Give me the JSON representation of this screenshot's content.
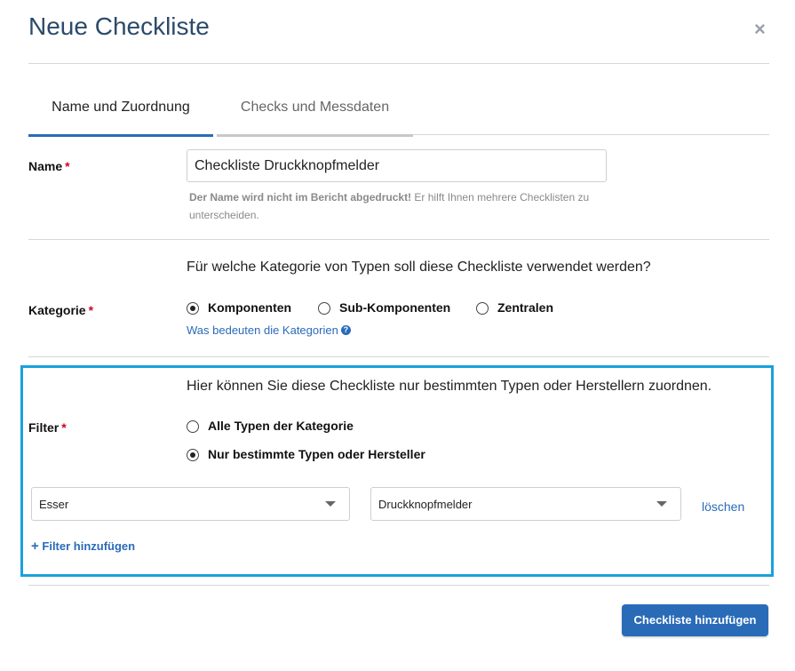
{
  "dialog": {
    "title": "Neue Checkliste",
    "close_glyph": "×"
  },
  "tabs": [
    {
      "label": "Name und Zuordnung",
      "active": true
    },
    {
      "label": "Checks und Messdaten",
      "active": false
    }
  ],
  "name": {
    "label": "Name",
    "required": "*",
    "value": "Checkliste Druckknopfmelder",
    "hint_bold": "Der Name wird nicht im Bericht abgedruckt!",
    "hint_text": " Er hilft Ihnen mehrere Checklisten zu unterscheiden."
  },
  "category": {
    "label": "Kategorie",
    "required": "*",
    "question": "Für welche Kategorie von Typen soll diese Checkliste verwendet werden?",
    "options": [
      {
        "label": "Komponenten",
        "checked": true
      },
      {
        "label": "Sub-Komponenten",
        "checked": false
      },
      {
        "label": "Zentralen",
        "checked": false
      }
    ],
    "help_link": "Was bedeuten die Kategorien",
    "help_icon": "?"
  },
  "filter": {
    "label": "Filter",
    "required": "*",
    "question": "Hier können Sie diese Checkliste nur bestimmten Typen oder Herstellern zuordnen.",
    "options": [
      {
        "label": "Alle Typen der Kategorie",
        "checked": false
      },
      {
        "label": "Nur bestimmte Typen oder Hersteller",
        "checked": true
      }
    ],
    "manufacturer_select": "Esser",
    "type_select": "Druckknopfmelder",
    "delete_link": "löschen",
    "add_filter_icon": "+",
    "add_filter_label": "Filter hinzufügen"
  },
  "footer": {
    "submit_label": "Checkliste hinzufügen"
  },
  "colors": {
    "accent": "#2a6bb8",
    "highlight": "#1aa1dc",
    "required": "#d0021b",
    "title": "#2c4a6a"
  }
}
